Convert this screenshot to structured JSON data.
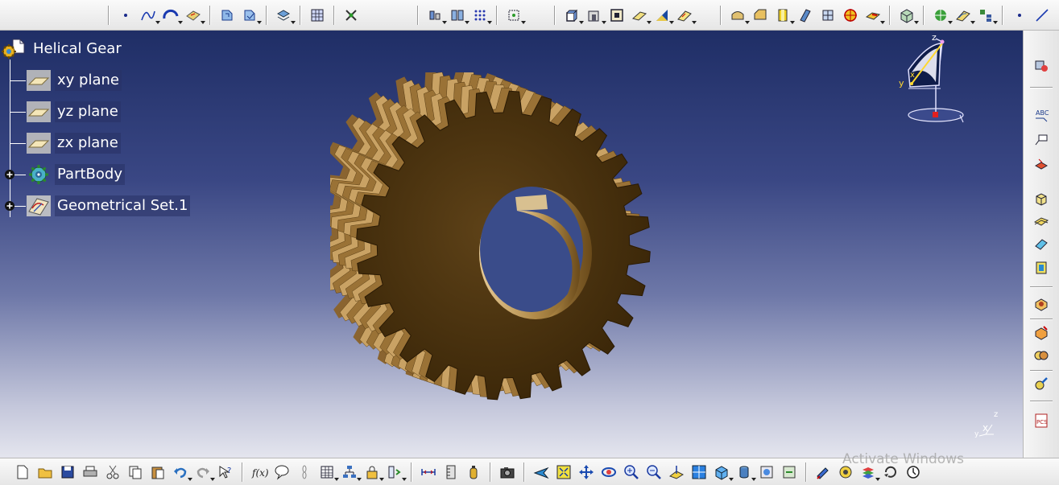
{
  "tree": {
    "root": {
      "label": "Helical Gear",
      "icon": "part-document-icon"
    },
    "items": [
      {
        "label": "xy plane",
        "icon": "plane-icon"
      },
      {
        "label": "yz plane",
        "icon": "plane-icon"
      },
      {
        "label": "zx plane",
        "icon": "plane-icon"
      },
      {
        "label": "PartBody",
        "icon": "partbody-gear-icon",
        "expandable": true
      },
      {
        "label": "Geometrical Set.1",
        "icon": "geometrical-set-icon",
        "expandable": true
      }
    ]
  },
  "compass": {
    "x_label": "x",
    "y_label": "y",
    "z_label": "z"
  },
  "axis_indicator": {
    "x_label": "x",
    "y_label": "y",
    "z_label": "z"
  },
  "watermark": "Activate Windows",
  "colors": {
    "viewport_top": "#1f2e66",
    "viewport_bottom": "#e4e5ee",
    "gear_bronze": "#b48a4a",
    "gear_face": "#4a3212",
    "tree_text": "#ffffff"
  }
}
